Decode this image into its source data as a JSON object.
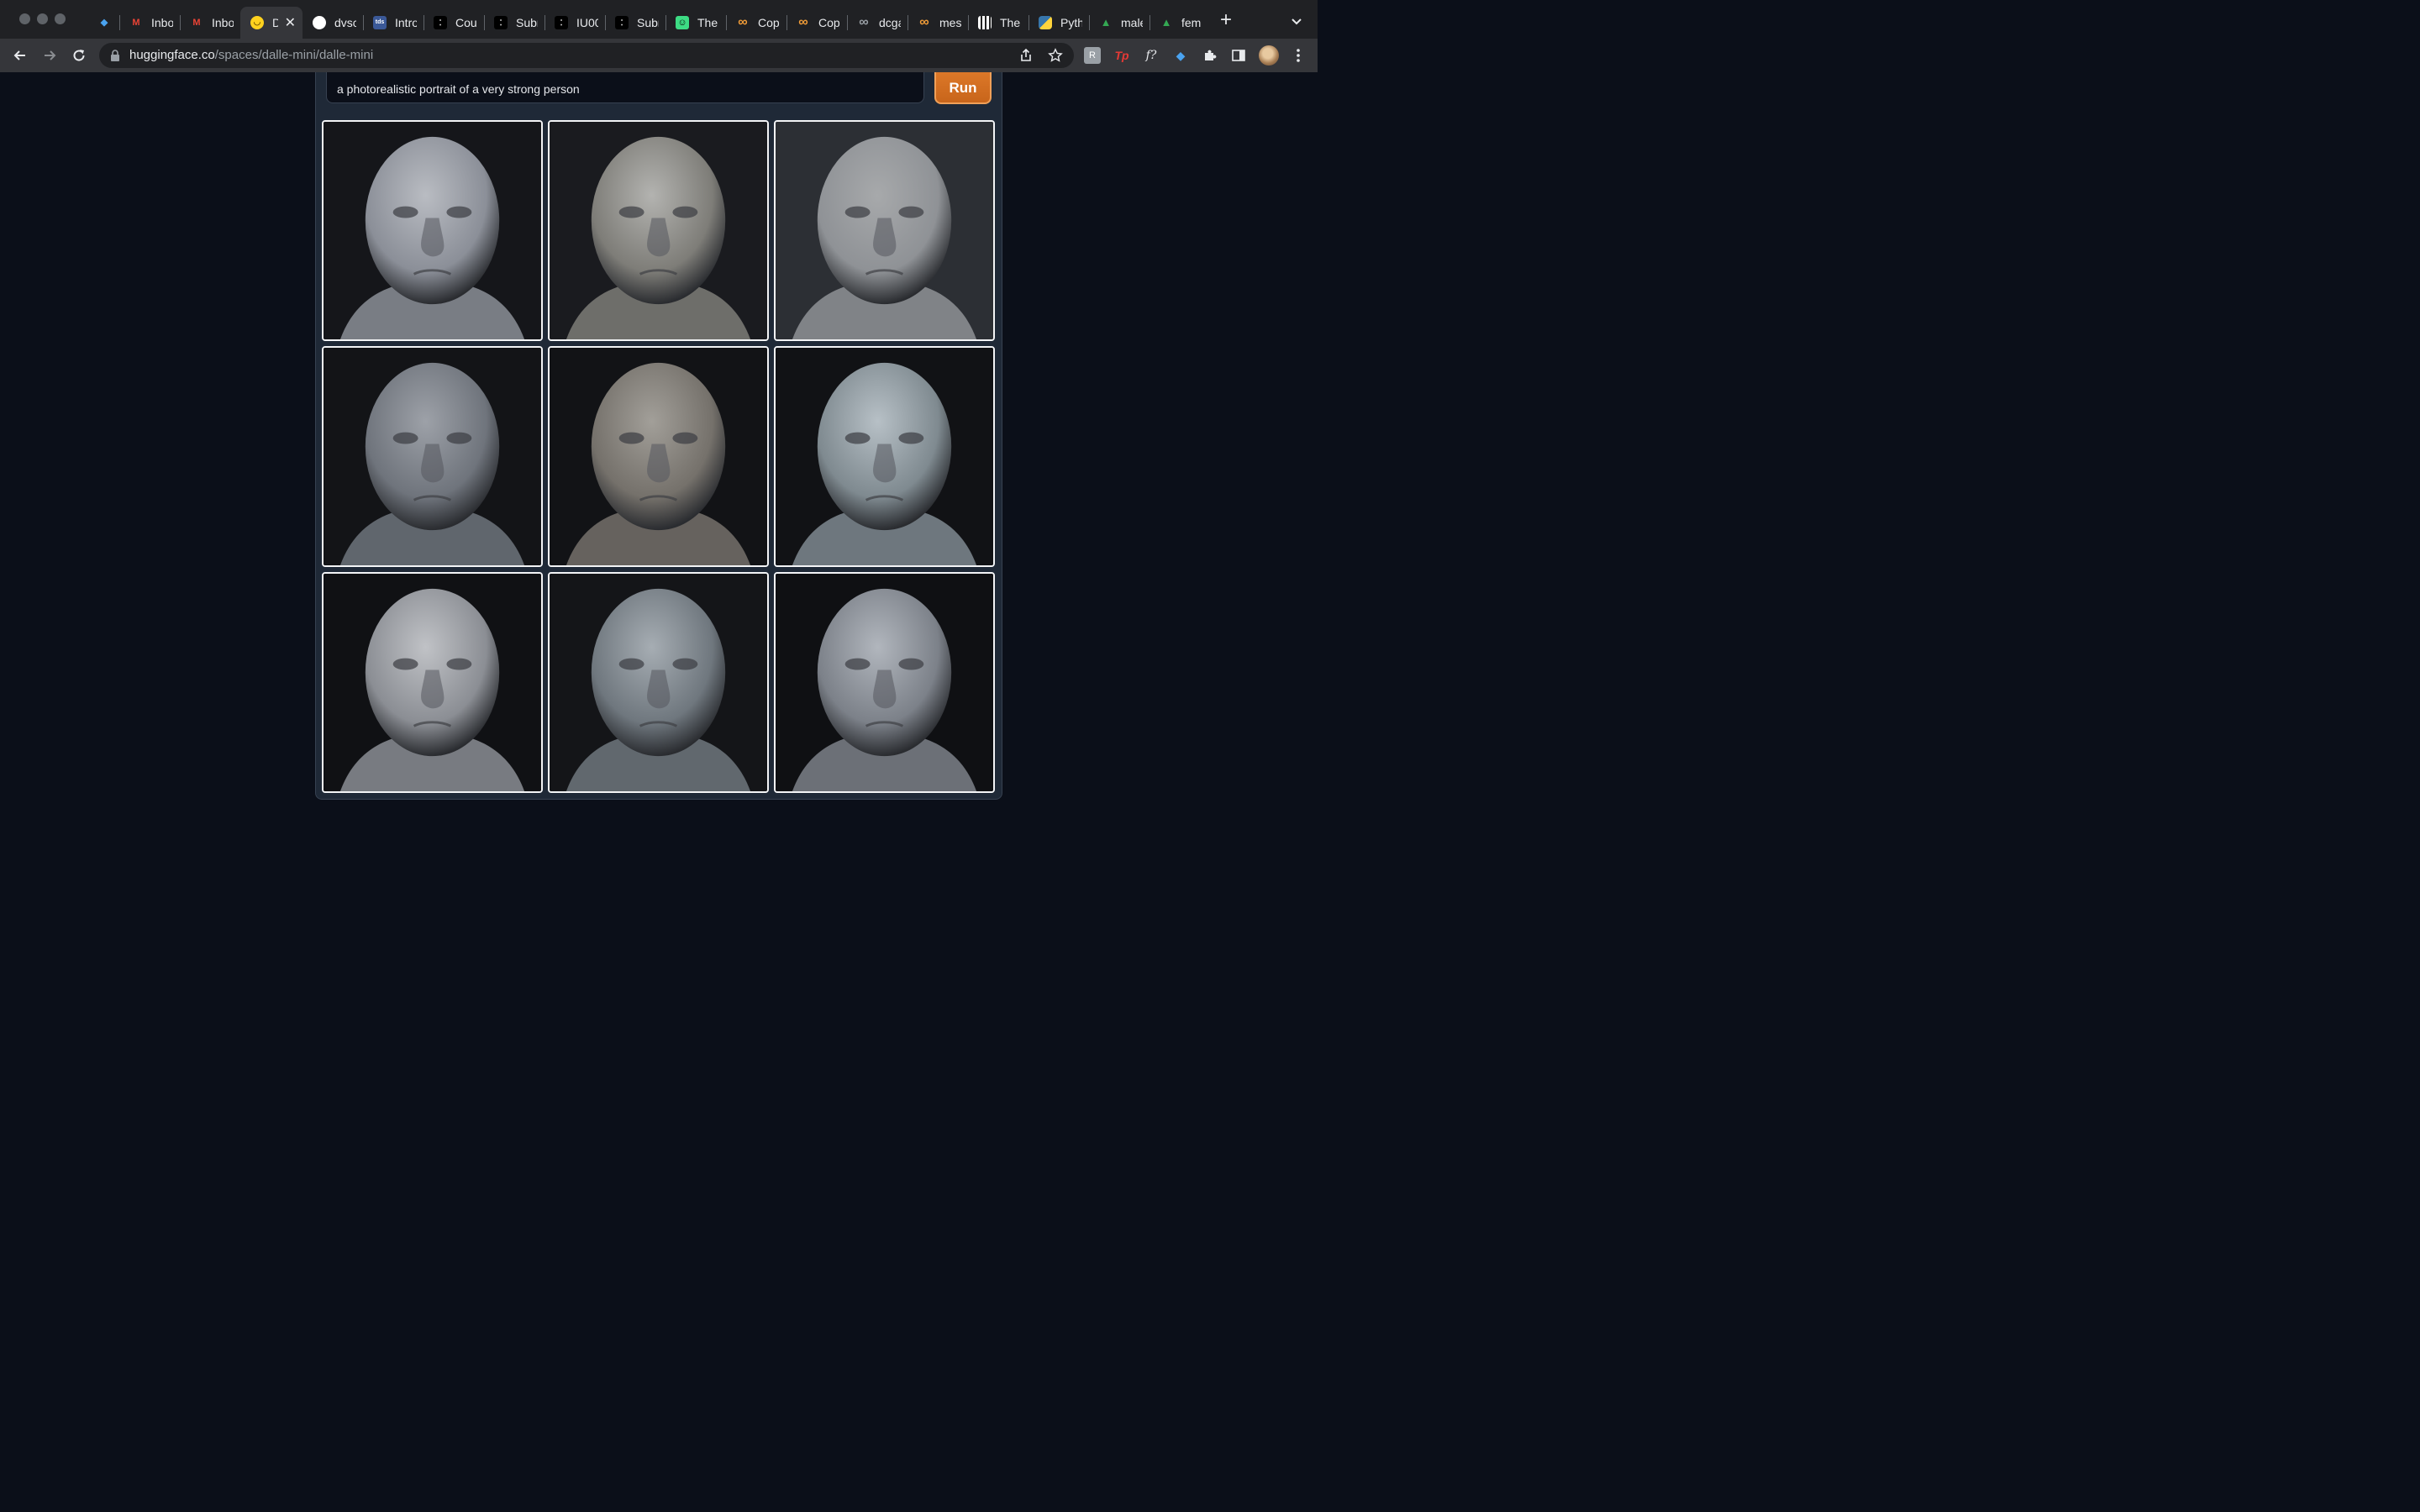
{
  "browser": {
    "tabs": [
      {
        "title": "",
        "icon": "gem-icon",
        "color": "#4aa3f0"
      },
      {
        "title": "Inbo",
        "icon": "gmail-icon",
        "color": "#ea4335"
      },
      {
        "title": "Inbo",
        "icon": "gmail-icon",
        "color": "#ea4335"
      },
      {
        "title": "D",
        "icon": "huggingface-icon",
        "color": "#ffd21e",
        "active": true
      },
      {
        "title": "dvsc",
        "icon": "github-icon",
        "color": "#ffffff"
      },
      {
        "title": "Intro",
        "icon": "tds-icon",
        "color": "#3b5998"
      },
      {
        "title": "Cour",
        "icon": "dots-icon",
        "color": "#ffffff"
      },
      {
        "title": "Subr",
        "icon": "dots-icon",
        "color": "#ffffff"
      },
      {
        "title": "IU00",
        "icon": "dots-icon",
        "color": "#ffffff"
      },
      {
        "title": "Subr",
        "icon": "dots-icon",
        "color": "#ffffff"
      },
      {
        "title": "The",
        "icon": "smiley-icon",
        "color": "#3ddc84"
      },
      {
        "title": "Cop",
        "icon": "infinity-icon",
        "color": "#f29d38"
      },
      {
        "title": "Cop",
        "icon": "infinity-icon",
        "color": "#f29d38"
      },
      {
        "title": "dcga",
        "icon": "infinity-icon",
        "color": "#9aa0a6"
      },
      {
        "title": "mes",
        "icon": "infinity-icon",
        "color": "#f29d38"
      },
      {
        "title": "The",
        "icon": "qr-icon",
        "color": "#ffffff"
      },
      {
        "title": "Pyth",
        "icon": "python-icon",
        "color": "#ffd43b"
      },
      {
        "title": "male",
        "icon": "drive-icon",
        "color": "#34a853"
      },
      {
        "title": "fema",
        "icon": "drive-icon",
        "color": "#34a853"
      }
    ],
    "url_host": "huggingface.co",
    "url_path": "/spaces/dalle-mini/dalle-mini"
  },
  "app": {
    "prompt": "a photorealistic portrait of a very strong person",
    "run_label": "Run",
    "accent": "#d97014",
    "images": [
      {
        "label": "generated portrait 1"
      },
      {
        "label": "generated portrait 2"
      },
      {
        "label": "generated portrait 3"
      },
      {
        "label": "generated portrait 4"
      },
      {
        "label": "generated portrait 5"
      },
      {
        "label": "generated portrait 6"
      },
      {
        "label": "generated portrait 7"
      },
      {
        "label": "generated portrait 8"
      },
      {
        "label": "generated portrait 9"
      }
    ]
  }
}
